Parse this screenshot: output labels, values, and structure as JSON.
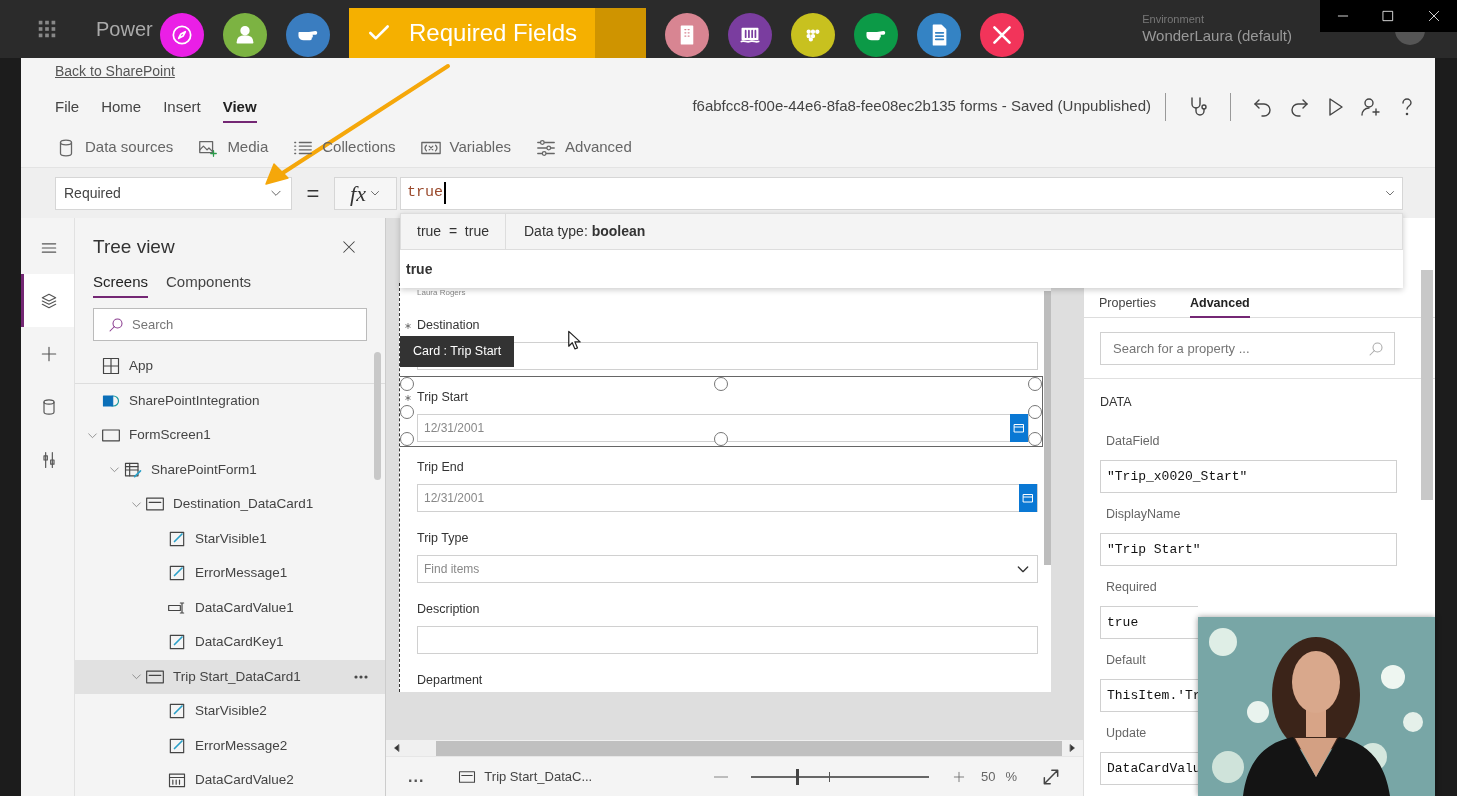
{
  "annotation_toolbar": {
    "tools_left": [
      {
        "kind": "compass",
        "color": "#ea1fe6"
      },
      {
        "kind": "person",
        "color": "#7cb342"
      },
      {
        "kind": "pointer",
        "color": "#3a7dc0"
      }
    ],
    "banner": {
      "label": "Required Fields"
    },
    "tools_right": [
      {
        "kind": "building",
        "color": "#d88592"
      },
      {
        "kind": "library",
        "color": "#7a3d9f"
      },
      {
        "kind": "dots",
        "color": "#c8c11f"
      },
      {
        "kind": "pointer",
        "color": "#0c9a47"
      },
      {
        "kind": "document",
        "color": "#3483c4"
      },
      {
        "kind": "tools",
        "color": "#f2345a"
      }
    ]
  },
  "top_bar": {
    "title_start": "Power",
    "environment_label": "Environment",
    "environment": "WonderLaura (default)"
  },
  "back_link": "Back to SharePoint",
  "menu": [
    {
      "label": "File",
      "selected": false
    },
    {
      "label": "Home",
      "selected": false
    },
    {
      "label": "Insert",
      "selected": false
    },
    {
      "label": "View",
      "selected": true
    }
  ],
  "document_title": "f6abfcc8-f00e-44e6-8fa8-fee08ec2b135 forms - Saved (Unpublished)",
  "ribbon": [
    {
      "kind": "database",
      "label": "Data sources"
    },
    {
      "kind": "media",
      "label": "Media"
    },
    {
      "kind": "list",
      "label": "Collections"
    },
    {
      "kind": "variable",
      "label": "Variables"
    },
    {
      "kind": "sliders",
      "label": "Advanced"
    }
  ],
  "formula_bar": {
    "property": "Required",
    "equals": "=",
    "fx_label": "fx",
    "formula": "true"
  },
  "intellisense": {
    "expression": "true  =  true",
    "data_type": "Data type: **boolean**",
    "suggestions": [
      "true"
    ]
  },
  "rail": [
    {
      "kind": "menu",
      "selected": false
    },
    {
      "kind": "layers",
      "selected": true
    },
    {
      "kind": "plus",
      "selected": false
    },
    {
      "kind": "database",
      "selected": false
    },
    {
      "kind": "tools",
      "selected": false
    }
  ],
  "tree_view": {
    "title": "Tree view",
    "tabs": [
      {
        "label": "Screens",
        "selected": true
      },
      {
        "label": "Components",
        "selected": false
      }
    ],
    "search_placeholder": "Search",
    "items": [
      {
        "kind": "app",
        "label": "App",
        "selected": false
      },
      {
        "kind": "sharepoint",
        "label": "SharePointIntegration",
        "selected": false
      },
      {
        "kind": "screen",
        "label": "FormScreen1",
        "selected": false,
        "expanded": true,
        "children": [
          {
            "kind": "form",
            "label": "SharePointForm1",
            "selected": false,
            "expanded": true,
            "children": [
              {
                "kind": "card",
                "label": "Destination_DataCard1",
                "selected": false,
                "expanded": true,
                "children": [
                  {
                    "kind": "label",
                    "label": "StarVisible1",
                    "selected": false
                  },
                  {
                    "kind": "label",
                    "label": "ErrorMessage1",
                    "selected": false
                  },
                  {
                    "kind": "text-input",
                    "label": "DataCardValue1",
                    "selected": false
                  },
                  {
                    "kind": "label",
                    "label": "DataCardKey1",
                    "selected": false
                  }
                ]
              },
              {
                "kind": "card",
                "label": "Trip Start_DataCard1",
                "selected": true,
                "expanded": true,
                "children": [
                  {
                    "kind": "label",
                    "label": "StarVisible2",
                    "selected": false
                  },
                  {
                    "kind": "label",
                    "label": "ErrorMessage2",
                    "selected": false
                  },
                  {
                    "kind": "date-picker",
                    "label": "DataCardValue2",
                    "selected": false
                  }
                ]
              }
            ]
          }
        ]
      }
    ]
  },
  "canvas": {
    "subtitle": "Laura Rogers",
    "tooltip": "Card : Trip Start",
    "fields": [
      {
        "kind": "text",
        "label": "Destination",
        "required": true,
        "selected": false
      },
      {
        "kind": "date",
        "label": "Trip Start",
        "required": true,
        "selected": true,
        "value": "12/31/2001"
      },
      {
        "kind": "date",
        "label": "Trip End",
        "required": false,
        "selected": false,
        "value": "12/31/2001"
      },
      {
        "kind": "dropdown",
        "label": "Trip Type",
        "required": false,
        "selected": false,
        "placeholder": "Find items"
      },
      {
        "kind": "text",
        "label": "Description",
        "required": false,
        "selected": false
      },
      {
        "kind": "label",
        "label": "Department",
        "required": false,
        "selected": false
      }
    ]
  },
  "status_bar": {
    "more": "...",
    "breadcrumb": "Trip Start_DataC...",
    "zoom_slider": {
      "level": 0.26
    },
    "zoom": "50",
    "unit": "%"
  },
  "properties_panel": {
    "tabs": [
      {
        "label": "Properties",
        "selected": false
      },
      {
        "label": "Advanced",
        "selected": true
      }
    ],
    "search_placeholder": "Search for a property ...",
    "section": "DATA",
    "properties": [
      {
        "label": "DataField",
        "value": "\"Trip_x0020_Start\""
      },
      {
        "label": "DisplayName",
        "value": "\"Trip Start\""
      },
      {
        "label": "Required",
        "value": "true"
      },
      {
        "label": "Default",
        "value": "ThisItem.'Tr"
      },
      {
        "label": "Update",
        "value": "DataCardValu"
      }
    ]
  }
}
